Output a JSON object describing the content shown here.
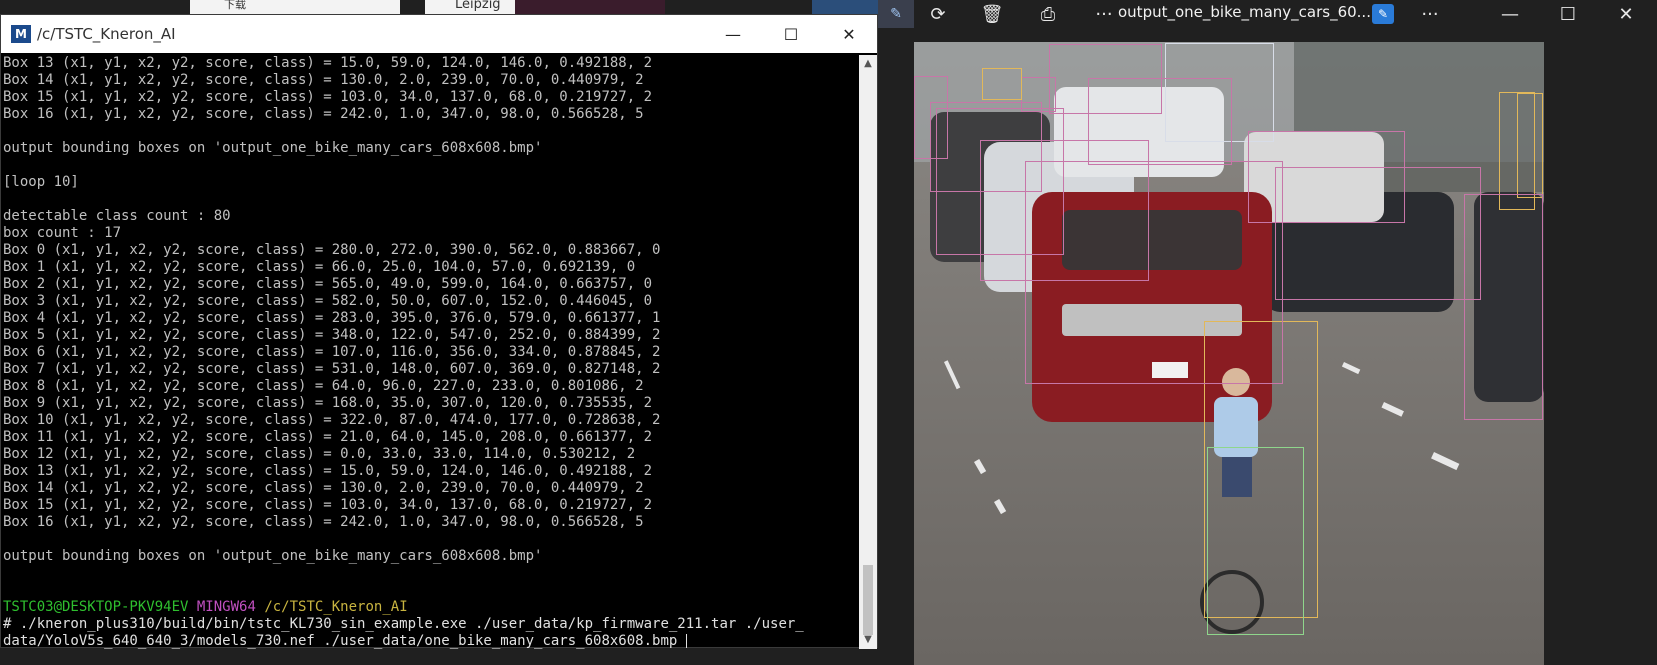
{
  "background_tabs": [
    "下载",
    "Leipzig"
  ],
  "terminal": {
    "title": "/c/TSTC_Kneron_AI",
    "icon_glyph": "M",
    "lines": [
      "Box 13 (x1, y1, x2, y2, score, class) = 15.0, 59.0, 124.0, 146.0, 0.492188, 2",
      "Box 14 (x1, y1, x2, y2, score, class) = 130.0, 2.0, 239.0, 70.0, 0.440979, 2",
      "Box 15 (x1, y1, x2, y2, score, class) = 103.0, 34.0, 137.0, 68.0, 0.219727, 2",
      "Box 16 (x1, y1, x2, y2, score, class) = 242.0, 1.0, 347.0, 98.0, 0.566528, 5",
      "",
      "output bounding boxes on 'output_one_bike_many_cars_608x608.bmp'",
      "",
      "[loop 10]",
      "",
      "detectable class count : 80",
      "box count : 17",
      "Box 0 (x1, y1, x2, y2, score, class) = 280.0, 272.0, 390.0, 562.0, 0.883667, 0",
      "Box 1 (x1, y1, x2, y2, score, class) = 66.0, 25.0, 104.0, 57.0, 0.692139, 0",
      "Box 2 (x1, y1, x2, y2, score, class) = 565.0, 49.0, 599.0, 164.0, 0.663757, 0",
      "Box 3 (x1, y1, x2, y2, score, class) = 582.0, 50.0, 607.0, 152.0, 0.446045, 0",
      "Box 4 (x1, y1, x2, y2, score, class) = 283.0, 395.0, 376.0, 579.0, 0.661377, 1",
      "Box 5 (x1, y1, x2, y2, score, class) = 348.0, 122.0, 547.0, 252.0, 0.884399, 2",
      "Box 6 (x1, y1, x2, y2, score, class) = 107.0, 116.0, 356.0, 334.0, 0.878845, 2",
      "Box 7 (x1, y1, x2, y2, score, class) = 531.0, 148.0, 607.0, 369.0, 0.827148, 2",
      "Box 8 (x1, y1, x2, y2, score, class) = 64.0, 96.0, 227.0, 233.0, 0.801086, 2",
      "Box 9 (x1, y1, x2, y2, score, class) = 168.0, 35.0, 307.0, 120.0, 0.735535, 2",
      "Box 10 (x1, y1, x2, y2, score, class) = 322.0, 87.0, 474.0, 177.0, 0.728638, 2",
      "Box 11 (x1, y1, x2, y2, score, class) = 21.0, 64.0, 145.0, 208.0, 0.661377, 2",
      "Box 12 (x1, y1, x2, y2, score, class) = 0.0, 33.0, 33.0, 114.0, 0.530212, 2",
      "Box 13 (x1, y1, x2, y2, score, class) = 15.0, 59.0, 124.0, 146.0, 0.492188, 2",
      "Box 14 (x1, y1, x2, y2, score, class) = 130.0, 2.0, 239.0, 70.0, 0.440979, 2",
      "Box 15 (x1, y1, x2, y2, score, class) = 103.0, 34.0, 137.0, 68.0, 0.219727, 2",
      "Box 16 (x1, y1, x2, y2, score, class) = 242.0, 1.0, 347.0, 98.0, 0.566528, 5",
      "",
      "output bounding boxes on 'output_one_bike_many_cars_608x608.bmp'",
      "",
      ""
    ],
    "prompt": {
      "user_host": "TSTC03@DESKTOP-PKV94EV",
      "env": "MINGW64",
      "path": "/c/TSTC_Kneron_AI"
    },
    "command_line_1": "# ./kneron_plus310/build/bin/tstc_KL730_sin_example.exe ./user_data/kp_firmware_211.tar ./user_",
    "command_line_2": "data/YoloV5s_640_640_3/models_730.nef ./user_data/one_bike_many_cars_608x608.bmp "
  },
  "viewer": {
    "filename": "output_one_bike_many_cars_60...",
    "icons": [
      "edit-partial-icon",
      "rotate-icon",
      "delete-icon",
      "print-icon",
      "more-icon",
      "edit-icon",
      "more-icon",
      "minimize-icon",
      "maximize-icon",
      "close-icon"
    ]
  },
  "colors": {
    "box_person": "#e2b85a",
    "box_bike": "#8fd68c",
    "box_car": "#c776a8",
    "box_bus": "#d8dde8"
  }
}
